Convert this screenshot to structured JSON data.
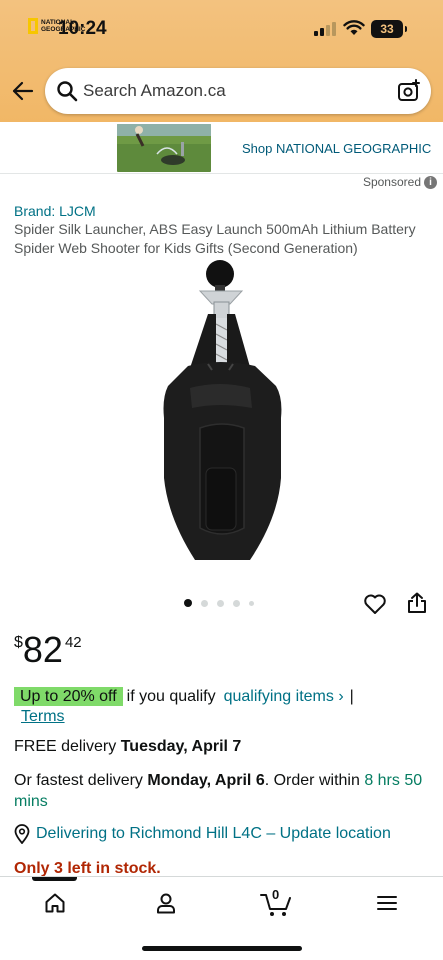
{
  "status_bar": {
    "time": "10:24",
    "battery": "33"
  },
  "search": {
    "placeholder": "Search Amazon.ca"
  },
  "ad": {
    "logo_line1": "NATIONAL",
    "logo_line2": "GEOGRAPHIC",
    "cta": "Shop NATIONAL GEOGRAPHIC",
    "sponsored_label": "Sponsored",
    "info_glyph": "i"
  },
  "product": {
    "brand": "Brand: LJCM",
    "title": "Spider Silk Launcher, ABS Easy Launch 500mAh Lithium Battery Spider Web Shooter for Kids Gifts (Second Generation)",
    "image_count": 5,
    "active_image": 1
  },
  "price": {
    "symbol": "$",
    "whole": "82",
    "fraction": "42"
  },
  "promo": {
    "badge": "Up to 20% off",
    "text": "if you qualify",
    "link": "qualifying items ›",
    "separator": "|",
    "terms": "Terms"
  },
  "delivery": {
    "free_prefix": "FREE delivery ",
    "free_date": "Tuesday, April 7",
    "fastest_prefix": "Or fastest delivery ",
    "fastest_date": "Monday, April 6",
    "order_within": ". Order within ",
    "countdown": "8 hrs 50 mins"
  },
  "location": {
    "text": "Delivering to Richmond Hill L4C – Update location"
  },
  "stock": {
    "text": "Only 3 left in stock."
  },
  "bottom_nav": {
    "cart_count": "0",
    "active": "home"
  },
  "colors": {
    "header_bg": "#f3c27f",
    "link": "#007185",
    "promo_badge": "#7fda69",
    "stock_red": "#b12704",
    "countdown_green": "#067d62"
  },
  "icons": [
    "back-arrow-icon",
    "search-icon",
    "camera-icon",
    "info-icon",
    "heart-icon",
    "share-icon",
    "location-pin-icon",
    "home-icon",
    "account-icon",
    "cart-icon",
    "menu-icon"
  ]
}
